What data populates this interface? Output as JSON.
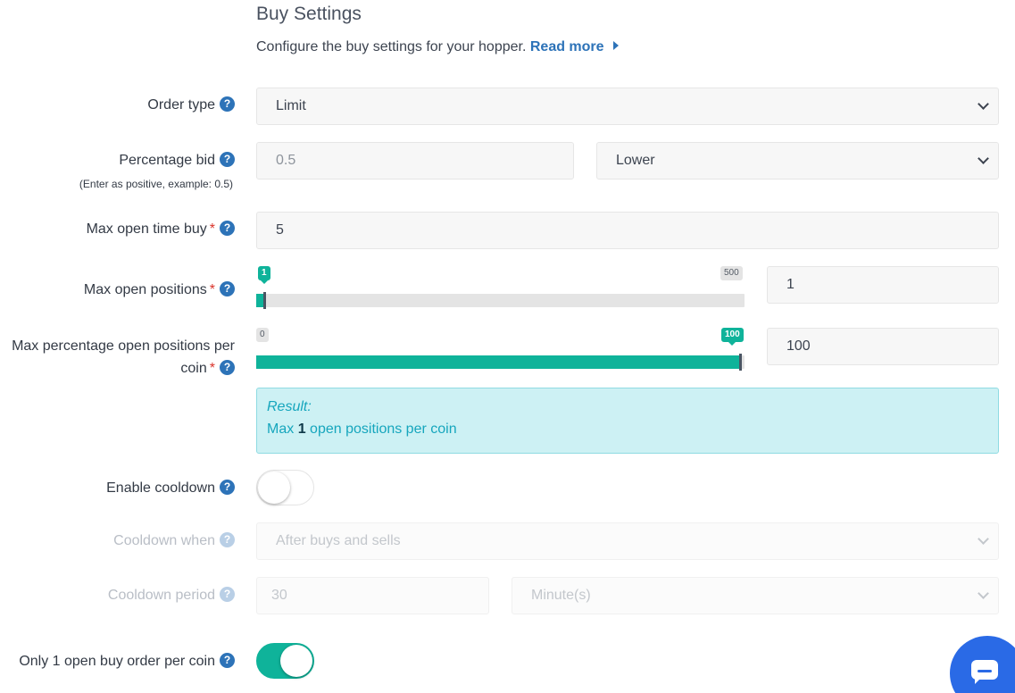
{
  "section": {
    "title": "Buy Settings",
    "description": "Configure the buy settings for your hopper.",
    "read_more": "Read more"
  },
  "help_glyph": "?",
  "required_mark": "*",
  "order_type": {
    "label": "Order type",
    "value": "Limit"
  },
  "percentage_bid": {
    "label": "Percentage bid",
    "sublabel": "(Enter as positive, example: 0.5)",
    "value": "0.5",
    "direction": "Lower"
  },
  "max_open_time_buy": {
    "label": "Max open time buy",
    "value": "5"
  },
  "max_open_positions": {
    "label": "Max open positions",
    "min": "1",
    "max": "500",
    "current": "1",
    "input_value": "1",
    "fraction": 0.0
  },
  "max_pct_open_positions": {
    "label": "Max percentage open positions per coin",
    "min": "0",
    "max": "100",
    "current": "100",
    "input_value": "100",
    "fraction": 1.0
  },
  "result": {
    "title": "Result:",
    "prefix": "Max",
    "value": "1",
    "suffix": "open positions per coin"
  },
  "enable_cooldown": {
    "label": "Enable cooldown",
    "enabled": false
  },
  "cooldown_when": {
    "label": "Cooldown when",
    "value": "After buys and sells"
  },
  "cooldown_period": {
    "label": "Cooldown period",
    "value": "30",
    "unit": "Minute(s)"
  },
  "only_one_open_buy": {
    "label": "Only 1 open buy order per coin",
    "enabled": true
  },
  "colors": {
    "accent": "#0fb39a",
    "link": "#2d73b8",
    "chat": "#2a6ae6",
    "required": "#d9342b"
  },
  "icons": {
    "help": "question-circle-icon",
    "dropdown": "chevron-down-icon",
    "read_more": "caret-right-icon",
    "chat": "chat-bubble-icon"
  }
}
